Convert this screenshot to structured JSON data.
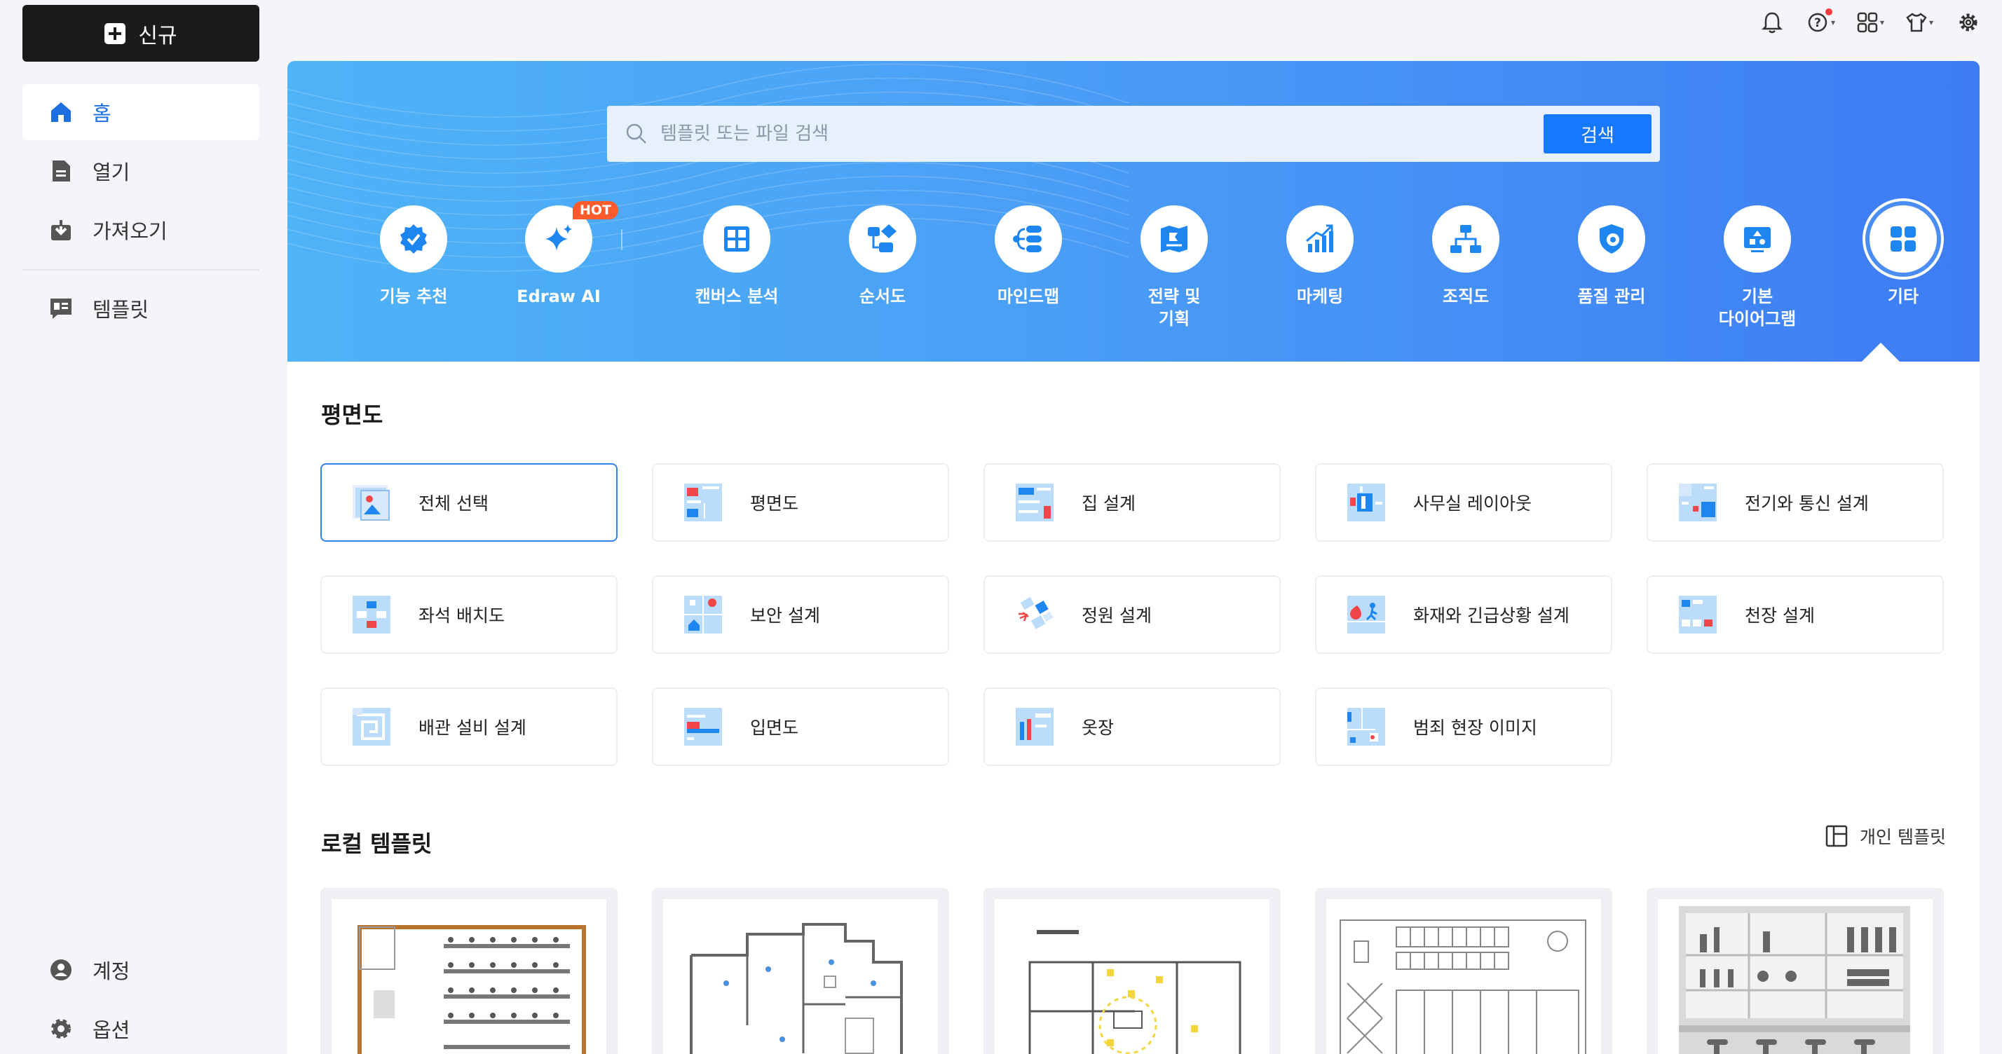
{
  "sidebar": {
    "new_label": "신규",
    "items": [
      {
        "label": "홈",
        "icon": "home-icon",
        "active": true
      },
      {
        "label": "열기",
        "icon": "file-icon"
      },
      {
        "label": "가져오기",
        "icon": "import-icon"
      },
      {
        "label": "템플릿",
        "icon": "template-icon"
      }
    ],
    "bottom": [
      {
        "label": "계정",
        "icon": "account-icon"
      },
      {
        "label": "옵션",
        "icon": "settings-gear-icon"
      }
    ]
  },
  "topbar": {
    "icons": [
      "bell-icon",
      "help-icon",
      "apps-icon",
      "tshirt-icon",
      "gear-icon"
    ],
    "help_has_notification": true
  },
  "search": {
    "placeholder": "템플릿 또는 파일 검색",
    "button_label": "검색"
  },
  "categories": [
    {
      "label": "기능 추천",
      "icon": "feature-badge-icon"
    },
    {
      "label": "Edraw AI",
      "icon": "ai-sparkle-icon",
      "badge": "HOT"
    },
    {
      "label": "캔버스 분석",
      "icon": "canvas-grid-icon"
    },
    {
      "label": "순서도",
      "icon": "flowchart-icon"
    },
    {
      "label": "마인드맵",
      "icon": "mindmap-icon"
    },
    {
      "label": "전략 및\n기획",
      "icon": "strategy-map-icon"
    },
    {
      "label": "마케팅",
      "icon": "marketing-chart-icon"
    },
    {
      "label": "조직도",
      "icon": "org-chart-icon"
    },
    {
      "label": "품질 관리",
      "icon": "quality-icon"
    },
    {
      "label": "기본\n다이어그램",
      "icon": "basic-diagram-icon"
    },
    {
      "label": "기타",
      "icon": "other-grid-icon",
      "selected": true
    }
  ],
  "floorplan": {
    "title": "평면도",
    "items": [
      {
        "label": "전체 선택",
        "selected": true
      },
      {
        "label": "평면도"
      },
      {
        "label": "집 설계"
      },
      {
        "label": "사무실 레이아웃"
      },
      {
        "label": "전기와 통신 설계"
      },
      {
        "label": "좌석 배치도"
      },
      {
        "label": "보안 설계"
      },
      {
        "label": "정원 설계"
      },
      {
        "label": "화재와 긴급상황 설계"
      },
      {
        "label": "천장 설계"
      },
      {
        "label": "배관 설비 설계"
      },
      {
        "label": "입면도"
      },
      {
        "label": "옷장"
      },
      {
        "label": "범죄 현장 이미지"
      }
    ]
  },
  "local": {
    "title": "로컬 템플릿",
    "personal_label": "개인 템플릿"
  },
  "colors": {
    "accent": "#1677ff",
    "hot": "#ff5a2c",
    "icon_blue": "#1e86f0",
    "icon_light": "#bcdcfb",
    "icon_red": "#f0464a"
  }
}
